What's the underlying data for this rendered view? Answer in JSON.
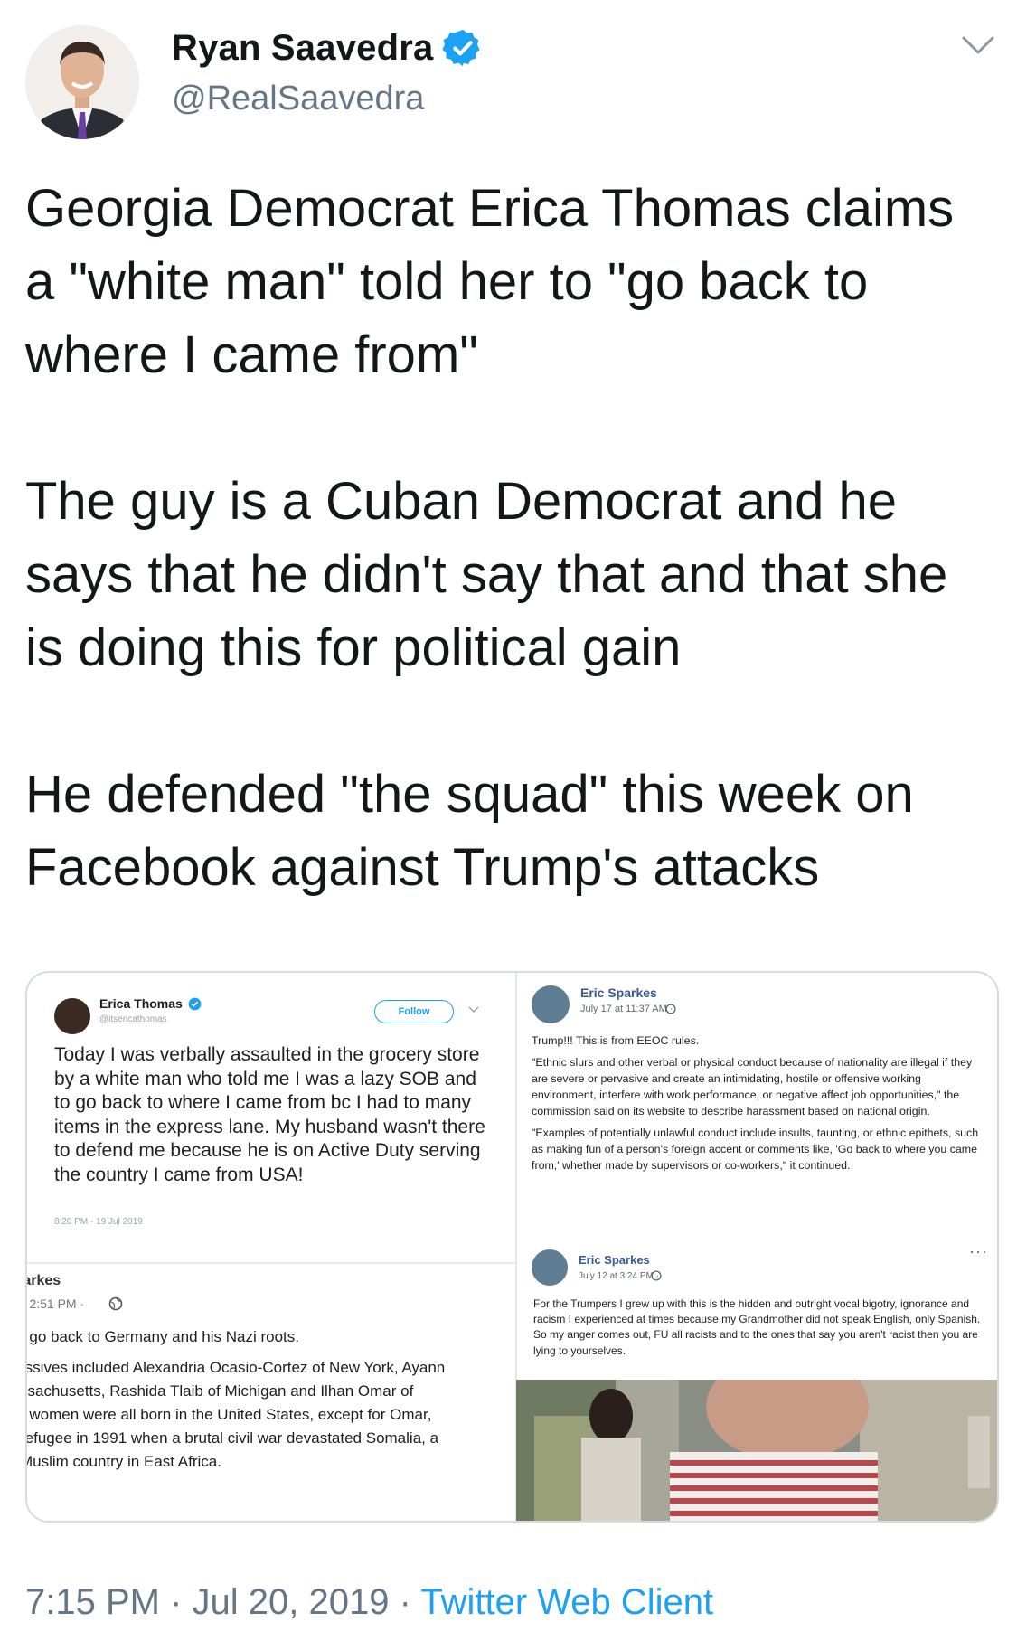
{
  "tweet": {
    "author_name": "Ryan Saavedra",
    "author_handle": "@RealSaavedra",
    "paragraphs": [
      "Georgia Democrat Erica Thomas claims a \"white man\" told her to \"go back to where I came from\"",
      "The guy is a Cuban Democrat and he says that he didn't say that and that she is doing this for political gain",
      "He defended \"the squad\" this week on Facebook against Trump's attacks"
    ],
    "time": "7:15 PM",
    "date": "Jul 20, 2019",
    "separator": "·",
    "client": "Twitter Web Client"
  },
  "icons": {
    "verified": "verified-badge-icon",
    "more": "chevron-down-icon",
    "globe": "globe-icon"
  },
  "colors": {
    "brand_blue": "#1da1f2",
    "secondary_text": "#657786",
    "facebook_link": "#385898"
  },
  "media": {
    "erica_post": {
      "name": "Erica Thomas",
      "handle": "@itsericathomas",
      "follow_label": "Follow",
      "text": "Today I was verbally assaulted in the grocery store by a white man who told me I was a lazy SOB and to go back to where I came from bc I had to many items in the express lane. My husband wasn't there to defend me because he is on Active Duty serving the country I came from USA!",
      "timestamp": "8:20 PM - 19 Jul 2019"
    },
    "cropped_post": {
      "name": "›arkes",
      "time": "›t 2:51 PM ·",
      "lines": [
        "› go back to Germany and his Nazi roots.",
        "›ssives included Alexandria Ocasio-Cortez of New York, Ayann",
        "ssachusetts, Rashida Tlaib of Michigan and Ilhan Omar of",
        "› women were all born in the United States, except for Omar,",
        "refugee in 1991 when a brutal civil war devastated Somalia, a",
        "Muslim country in East Africa."
      ]
    },
    "eeoc_post": {
      "name": "Eric Sparkes",
      "time": "July 17 at 11:37 AM ·",
      "paragraphs": [
        "Trump!!! This is from EEOC rules.",
        "\"Ethnic slurs and other verbal or physical conduct because of nationality are illegal if they are severe or pervasive and create an intimidating, hostile or offensive working environment, interfere with work performance, or negative affect job opportunities,\" the commission said on its website to describe harassment based on national origin.",
        "\"Examples of potentially unlawful conduct include insults, taunting, or ethnic epithets, such as making fun of a person's foreign accent or comments like, 'Go back to where you came from,' whether made by supervisors or co-workers,\" it continued."
      ]
    },
    "trumpers_post": {
      "name": "Eric Sparkes",
      "time": "July 12 at 3:24 PM ·",
      "more": "···",
      "text": "For the Trumpers I grew up with this is the hidden and outright vocal bigotry, ignorance and racism I experienced at times because my Grandmother did not speak English, only Spanish. So my anger comes out, FU all racists and to the ones that say you aren't racist then you are lying to yourselves."
    }
  }
}
